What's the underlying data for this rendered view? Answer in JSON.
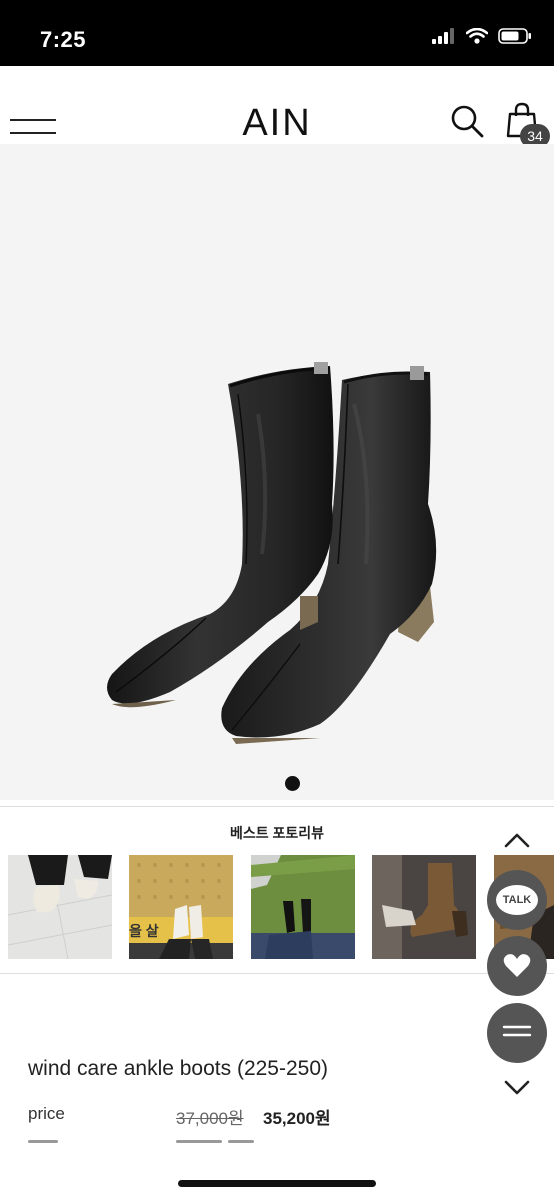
{
  "status_bar": {
    "time": "7:25"
  },
  "header": {
    "logo": "AIN",
    "cart_count": "34"
  },
  "hero": {
    "image_name": "black-ankle-boots"
  },
  "reviews": {
    "title": "베스트 포토리뷰",
    "sign_text": "을 살"
  },
  "floating": {
    "talk_label": "TALK"
  },
  "product": {
    "name": "wind care ankle boots (225-250)",
    "price_label": "price",
    "original_price": "37,000원",
    "sale_price": "35,200원"
  },
  "colors": {
    "accent_dark": "#222222",
    "float_gray": "#555555"
  }
}
